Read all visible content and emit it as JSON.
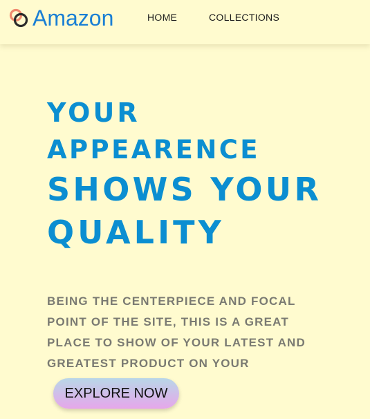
{
  "brand": {
    "name": "Amazon",
    "logo_icon": "interlocked-rings-icon",
    "brand_color": "#1a7fd4"
  },
  "nav": {
    "items": [
      {
        "label": "HOME"
      },
      {
        "label": "COLLECTIONS"
      }
    ]
  },
  "hero": {
    "title_lines": [
      "YOUR",
      "APPEARENCE",
      "SHOWS YOUR",
      "QUALITY"
    ],
    "title_color": "#0b8ed1",
    "description_lines": [
      "BEING THE CENTERPIECE AND FOCAL",
      "POINT OF THE SITE, THIS IS A GREAT",
      "PLACE TO SHOW OF YOUR LATEST AND",
      "GREATEST PRODUCT ON YOUR"
    ],
    "cta_label": "EXPLORE NOW"
  },
  "theme": {
    "background": "#fffbcf"
  }
}
